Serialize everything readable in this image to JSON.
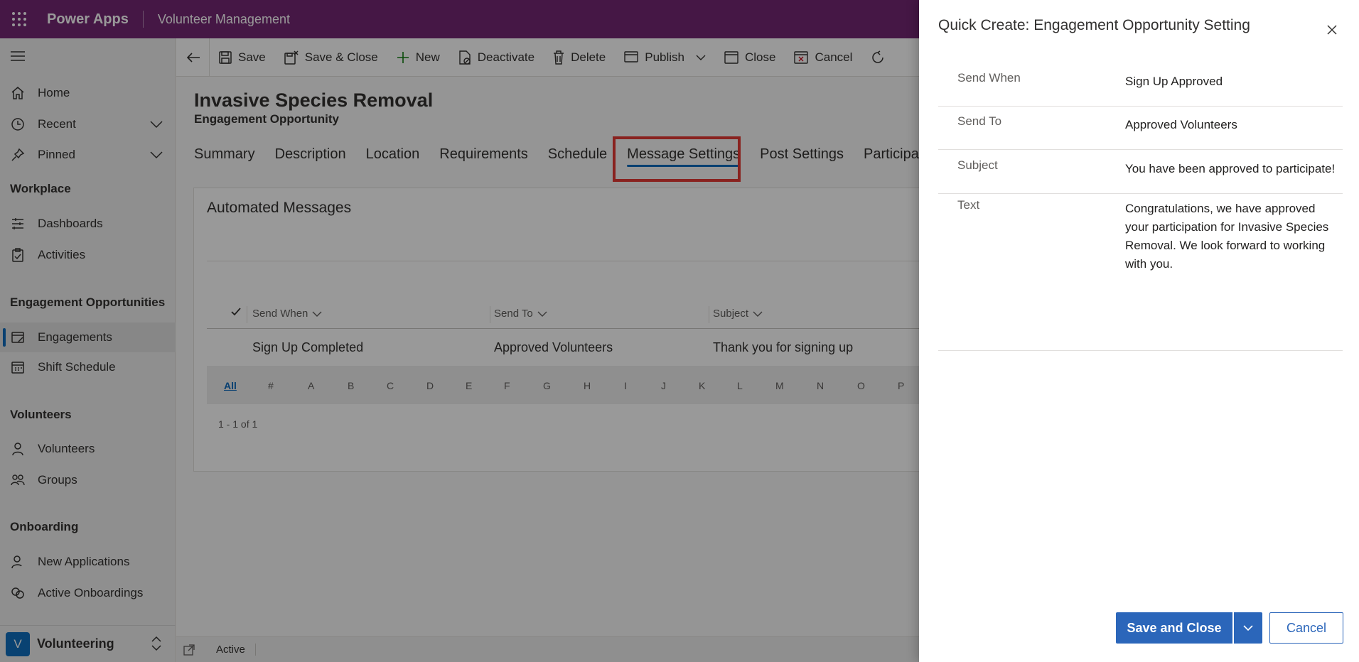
{
  "topbar": {
    "brand": "Power Apps",
    "app_name": "Volunteer Management"
  },
  "sidebar": {
    "items_top": [
      {
        "label": "Home",
        "icon": "home-icon"
      },
      {
        "label": "Recent",
        "icon": "clock-icon",
        "expandable": true
      },
      {
        "label": "Pinned",
        "icon": "pin-icon",
        "expandable": true
      }
    ],
    "groups": [
      {
        "title": "Workplace",
        "items": [
          {
            "label": "Dashboards",
            "icon": "dashboard-icon"
          },
          {
            "label": "Activities",
            "icon": "clipboard-icon"
          }
        ]
      },
      {
        "title": "Engagement Opportunities",
        "items": [
          {
            "label": "Engagements",
            "icon": "calendar-edit-icon",
            "selected": true
          },
          {
            "label": "Shift Schedule",
            "icon": "calendar-icon"
          }
        ]
      },
      {
        "title": "Volunteers",
        "items": [
          {
            "label": "Volunteers",
            "icon": "person-icon"
          },
          {
            "label": "Groups",
            "icon": "people-icon"
          }
        ]
      },
      {
        "title": "Onboarding",
        "items": [
          {
            "label": "New Applications",
            "icon": "person-add-icon"
          },
          {
            "label": "Active Onboardings",
            "icon": "rings-icon"
          }
        ]
      }
    ],
    "area": {
      "initial": "V",
      "name": "Volunteering"
    }
  },
  "commandbar": {
    "save": "Save",
    "save_close": "Save & Close",
    "new": "New",
    "deactivate": "Deactivate",
    "delete": "Delete",
    "publish": "Publish",
    "close": "Close",
    "cancel": "Cancel"
  },
  "record": {
    "title": "Invasive Species Removal",
    "entity": "Engagement Opportunity",
    "tabs": [
      "Summary",
      "Description",
      "Location",
      "Requirements",
      "Schedule",
      "Message Settings",
      "Post Settings",
      "Participant"
    ],
    "active_tab": "Message Settings"
  },
  "messages": {
    "section_title": "Automated Messages",
    "columns": [
      "Send When",
      "Send To",
      "Subject"
    ],
    "rows": [
      {
        "send_when": "Sign Up Completed",
        "send_to": "Approved Volunteers",
        "subject": "Thank you for signing up"
      }
    ],
    "jumpbar": [
      "All",
      "#",
      "A",
      "B",
      "C",
      "D",
      "E",
      "F",
      "G",
      "H",
      "I",
      "J",
      "K",
      "L",
      "M",
      "N",
      "O",
      "P"
    ],
    "paging": "1 - 1 of 1"
  },
  "statusbar": {
    "status": "Active"
  },
  "quick_create": {
    "title": "Quick Create: Engagement Opportunity Setting",
    "fields": [
      {
        "label": "Send When",
        "value": "Sign Up Approved"
      },
      {
        "label": "Send To",
        "value": "Approved Volunteers"
      },
      {
        "label": "Subject",
        "value": "You have been approved to participate!"
      },
      {
        "label": "Text",
        "value": "Congratulations, we have approved your participation for Invasive Species Removal. We look forward to working with you."
      }
    ],
    "save_close": "Save and Close",
    "cancel": "Cancel"
  },
  "colors": {
    "topbar": "#742774",
    "accent": "#2b66ba",
    "highlight": "#e53935"
  }
}
